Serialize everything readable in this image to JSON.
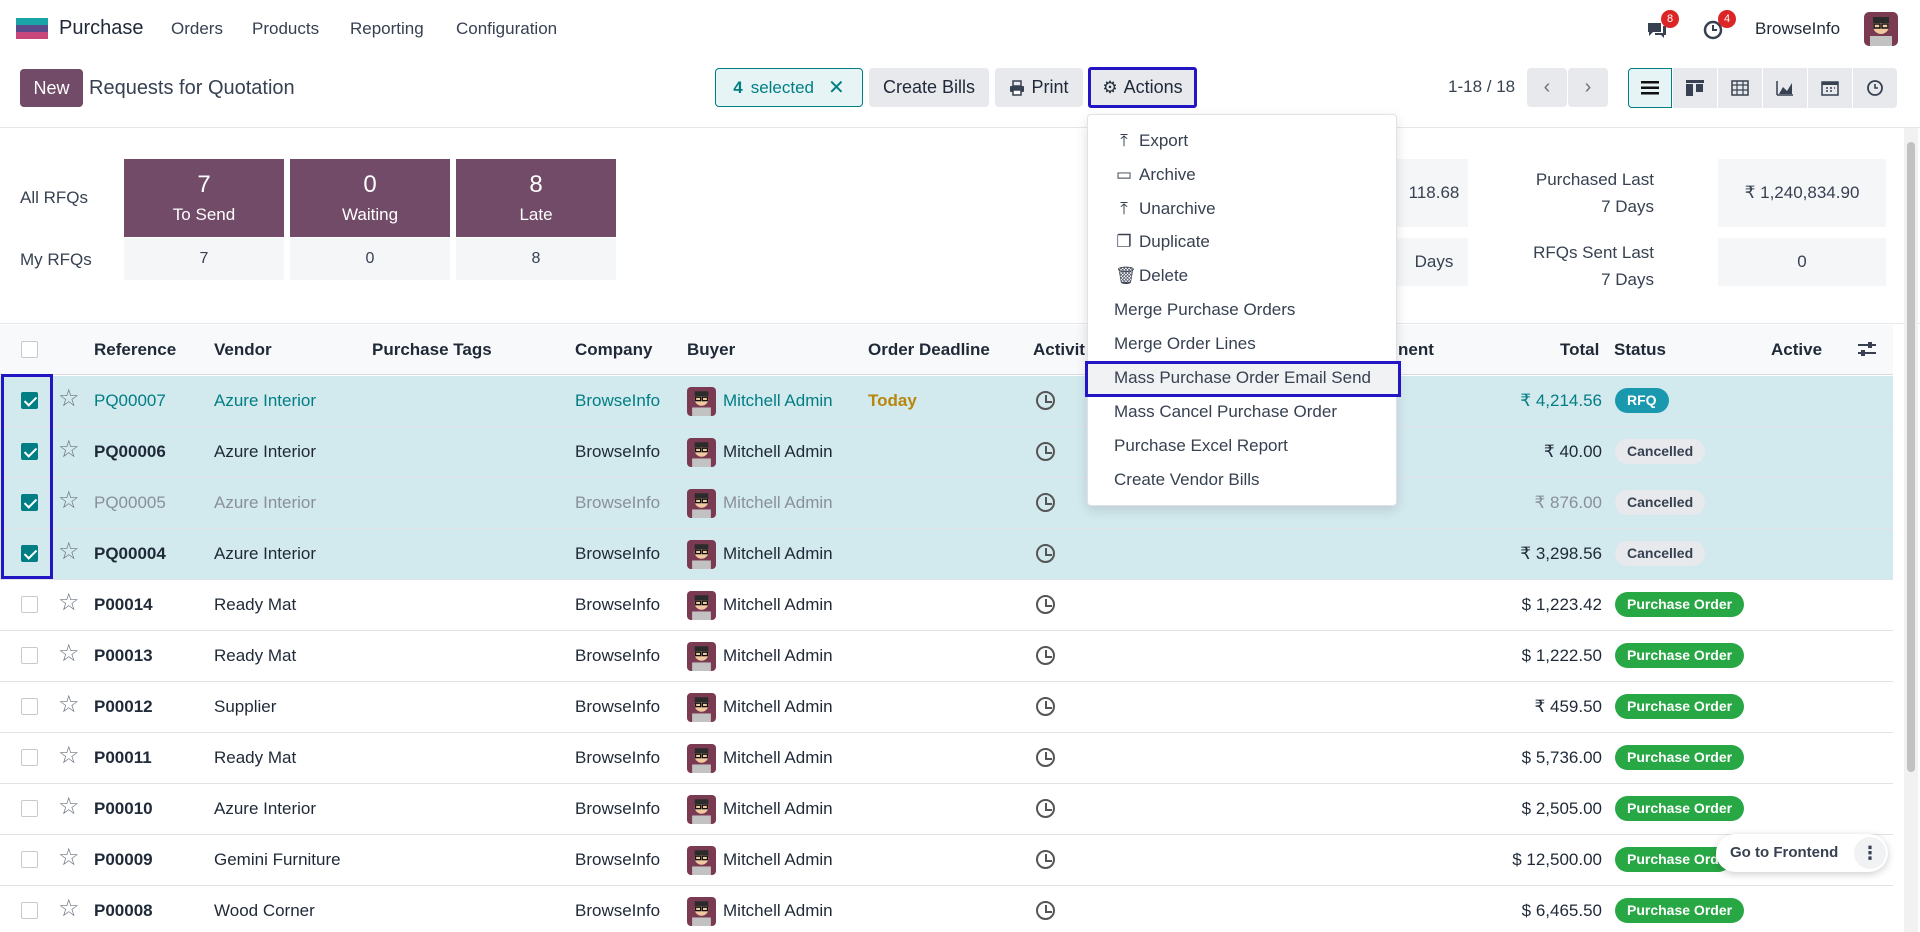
{
  "nav": {
    "app_name": "Purchase",
    "menus": [
      "Orders",
      "Products",
      "Reporting",
      "Configuration"
    ],
    "chat_count": "8",
    "activity_count": "4",
    "user": "BrowseInfo"
  },
  "control": {
    "new_label": "New",
    "title": "Requests for Quotation",
    "selected_count": "4",
    "selected_text": "selected",
    "create_bills": "Create Bills",
    "print": "Print",
    "actions": "Actions",
    "pager": "1-18 / 18"
  },
  "dashboard": {
    "all_rfqs": "All RFQs",
    "my_rfqs": "My RFQs",
    "tiles": [
      {
        "num": "7",
        "label": "To Send",
        "mine": "7"
      },
      {
        "num": "0",
        "label": "Waiting",
        "mine": "0"
      },
      {
        "num": "8",
        "label": "Late",
        "mine": "8"
      }
    ],
    "partial_value_1": "118.68",
    "partial_value_2": "Days",
    "purchased_label": "Purchased Last 7 Days",
    "purchased_value": "₹ 1,240,834.90",
    "rfqs_sent_label": "RFQs Sent Last 7 Days",
    "rfqs_sent_value": "0"
  },
  "table": {
    "headers": {
      "reference": "Reference",
      "vendor": "Vendor",
      "tags": "Purchase Tags",
      "company": "Company",
      "buyer": "Buyer",
      "deadline": "Order Deadline",
      "activities": "Activit",
      "payment": "nent",
      "total": "Total",
      "status": "Status",
      "active": "Active"
    },
    "rows": [
      {
        "ref": "PQ00007",
        "vendor": "Azure Interior",
        "company": "BrowseInfo",
        "buyer": "Mitchell Admin",
        "deadline": "Today",
        "total": "₹ 4,214.56",
        "status": "RFQ"
      },
      {
        "ref": "PQ00006",
        "vendor": "Azure Interior",
        "company": "BrowseInfo",
        "buyer": "Mitchell Admin",
        "deadline": "",
        "total": "₹ 40.00",
        "status": "Cancelled"
      },
      {
        "ref": "PQ00005",
        "vendor": "Azure Interior",
        "company": "BrowseInfo",
        "buyer": "Mitchell Admin",
        "deadline": "",
        "total": "₹ 876.00",
        "status": "Cancelled"
      },
      {
        "ref": "PQ00004",
        "vendor": "Azure Interior",
        "company": "BrowseInfo",
        "buyer": "Mitchell Admin",
        "deadline": "",
        "total": "₹ 3,298.56",
        "status": "Cancelled"
      },
      {
        "ref": "P00014",
        "vendor": "Ready Mat",
        "company": "BrowseInfo",
        "buyer": "Mitchell Admin",
        "deadline": "",
        "total": "$ 1,223.42",
        "status": "Purchase Order"
      },
      {
        "ref": "P00013",
        "vendor": "Ready Mat",
        "company": "BrowseInfo",
        "buyer": "Mitchell Admin",
        "deadline": "",
        "total": "$ 1,222.50",
        "status": "Purchase Order"
      },
      {
        "ref": "P00012",
        "vendor": "Supplier",
        "company": "BrowseInfo",
        "buyer": "Mitchell Admin",
        "deadline": "",
        "total": "₹ 459.50",
        "status": "Purchase Order"
      },
      {
        "ref": "P00011",
        "vendor": "Ready Mat",
        "company": "BrowseInfo",
        "buyer": "Mitchell Admin",
        "deadline": "",
        "total": "$ 5,736.00",
        "status": "Purchase Order"
      },
      {
        "ref": "P00010",
        "vendor": "Azure Interior",
        "company": "BrowseInfo",
        "buyer": "Mitchell Admin",
        "deadline": "",
        "total": "$ 2,505.00",
        "status": "Purchase Order"
      },
      {
        "ref": "P00009",
        "vendor": "Gemini Furniture",
        "company": "BrowseInfo",
        "buyer": "Mitchell Admin",
        "deadline": "",
        "total": "$ 12,500.00",
        "status": "Purchase Ord"
      },
      {
        "ref": "P00008",
        "vendor": "Wood Corner",
        "company": "BrowseInfo",
        "buyer": "Mitchell Admin",
        "deadline": "",
        "total": "$ 6,465.50",
        "status": "Purchase Order"
      }
    ]
  },
  "actions_menu": {
    "items": [
      "Export",
      "Archive",
      "Unarchive",
      "Duplicate",
      "Delete",
      "Merge Purchase Orders",
      "Merge Order Lines",
      "Mass Purchase Order Email Send",
      "Mass Cancel Purchase Order",
      "Purchase Excel Report",
      "Create Vendor Bills"
    ],
    "highlighted": "Mass Purchase Order Email Send"
  },
  "frontend_button": "Go to Frontend",
  "colors": {
    "brand": "#714b67",
    "teal": "#017e84",
    "highlight": "#2415c4",
    "rfq": "#1a98ad",
    "purchase_order": "#28a745"
  }
}
